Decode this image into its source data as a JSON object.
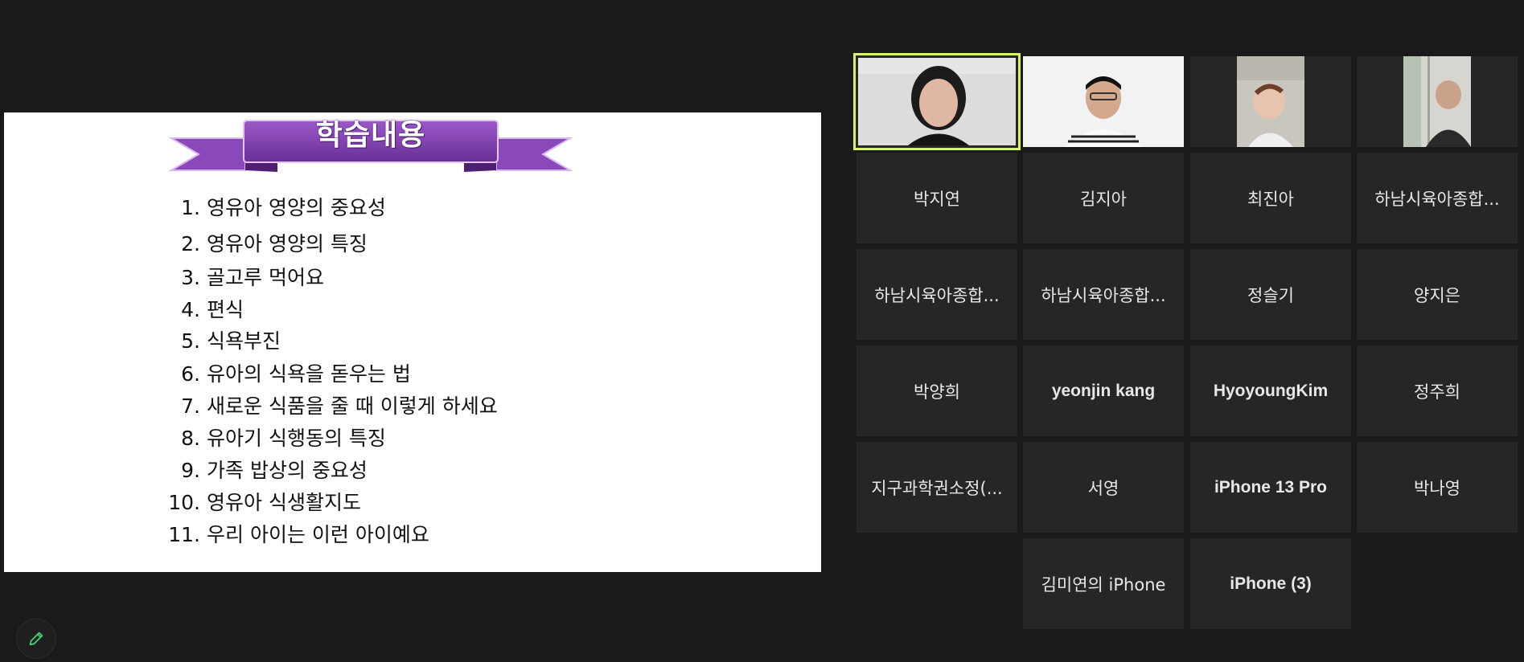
{
  "slide": {
    "title": "학습내용",
    "topics": [
      {
        "num": "1.",
        "text": "영유아 영양의 중요성"
      },
      {
        "num": "2.",
        "text": "영유아 영양의 특징"
      },
      {
        "num": "3.",
        "text": "골고루 먹어요"
      },
      {
        "num": "4.",
        "text": "편식"
      },
      {
        "num": "5.",
        "text": "식욕부진"
      },
      {
        "num": "6.",
        "text": "유아의 식욕을 돋우는 법"
      },
      {
        "num": "7.",
        "text": "새로운 식품을 줄 때 이렇게 하세요"
      },
      {
        "num": "8.",
        "text": "유아기 식행동의 특징"
      },
      {
        "num": "9.",
        "text": "가족 밥상의 중요성"
      },
      {
        "num": "10.",
        "text": "영유아 식생활지도"
      },
      {
        "num": "11.",
        "text": "우리 아이는 이런 아이예요"
      }
    ]
  },
  "participants": {
    "names": [
      "박지연",
      "김지아",
      "최진아",
      "하남시육아종합...",
      "하남시육아종합...",
      "하남시육아종합...",
      "정슬기",
      "양지은",
      "박양희",
      "yeonjin kang",
      "HyoyoungKim",
      "정주희",
      "지구과학권소정(...",
      "서영",
      "iPhone 13 Pro",
      "박나영",
      "김미연의 iPhone",
      "iPhone (3)"
    ]
  },
  "colors": {
    "background": "#1a1a1a",
    "tile": "#262626",
    "active_speaker_border": "#d6f36a",
    "banner_purple": "#7b3fa8",
    "edit_icon": "#3fcf7a"
  },
  "icons": {
    "edit_button": "pencil-icon"
  }
}
